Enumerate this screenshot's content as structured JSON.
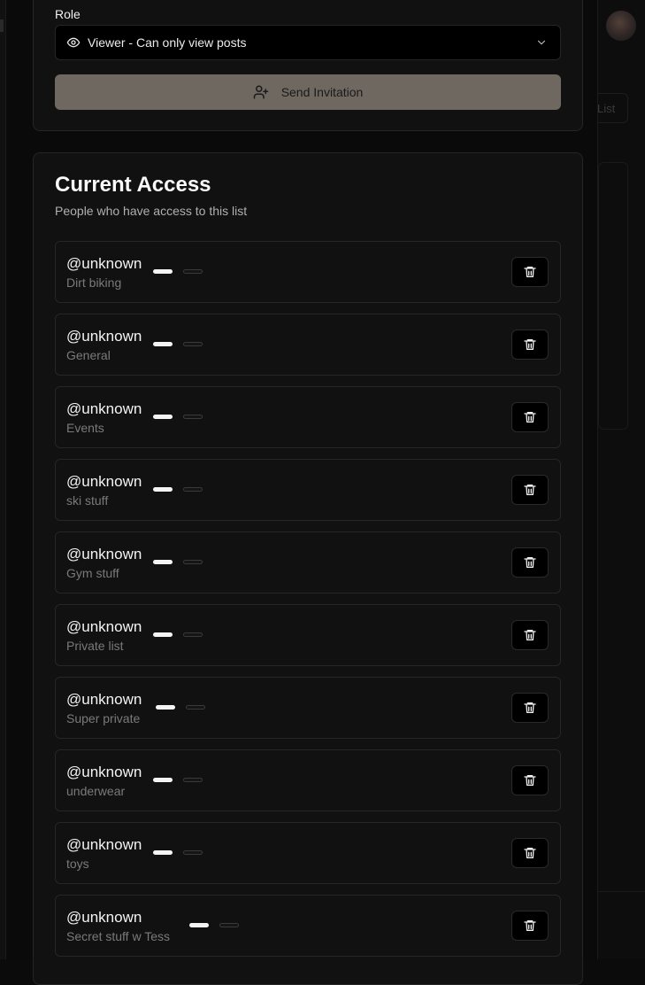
{
  "background": {
    "list_button_label": "List"
  },
  "invite_form": {
    "role_label": "Role",
    "role_value": "Viewer - Can only view posts",
    "role_icon": "eye-icon",
    "send_label": "Send Invitation",
    "send_icon": "user-plus-icon",
    "accent_color": "#6e6860"
  },
  "current_access": {
    "title": "Current Access",
    "subtitle": "People who have access to this list",
    "entries": [
      {
        "user": "@unknown",
        "list": "Dirt biking"
      },
      {
        "user": "@unknown",
        "list": "General"
      },
      {
        "user": "@unknown",
        "list": "Events"
      },
      {
        "user": "@unknown",
        "list": "ski stuff"
      },
      {
        "user": "@unknown",
        "list": "Gym stuff"
      },
      {
        "user": "@unknown",
        "list": "Private list"
      },
      {
        "user": "@unknown",
        "list": "Super private"
      },
      {
        "user": "@unknown",
        "list": "underwear"
      },
      {
        "user": "@unknown",
        "list": "toys"
      },
      {
        "user": "@unknown",
        "list": "Secret stuff w Tess"
      }
    ],
    "remove_icon": "trash-icon"
  }
}
